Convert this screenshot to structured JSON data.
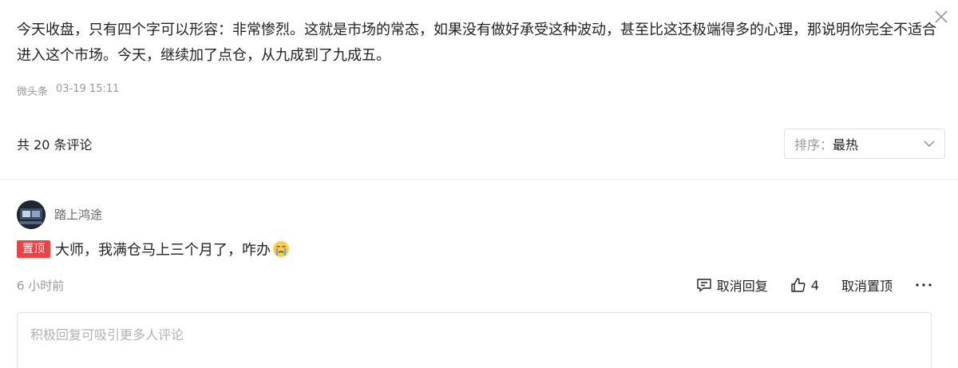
{
  "post": {
    "text": "今天收盘，只有四个字可以形容：非常惨烈。这就是市场的常态，如果没有做好承受这种波动，甚至比这还极端得多的心理，那说明你完全不适合进入这个市场。今天，继续加了点仓，从九成到了九成五。",
    "source": "微头条",
    "timestamp": "03-19 15:11"
  },
  "comments_header": {
    "count_text": "共 20 条评论",
    "sort_label": "排序：",
    "sort_value": "最热"
  },
  "comment": {
    "username": "踏上鸿途",
    "pin_badge": "置顶",
    "text": "大师，我满仓马上三个月了，咋办",
    "emoji": "crying-face-emoji",
    "time": "6 小时前",
    "reply_action": "取消回复",
    "like_count": "4",
    "unpin_action": "取消置顶"
  },
  "reply_input": {
    "placeholder": "积极回复可吸引更多人评论"
  },
  "colors": {
    "badge_red": "#f04142",
    "muted_text": "#999999",
    "border": "#e1e1e1"
  }
}
